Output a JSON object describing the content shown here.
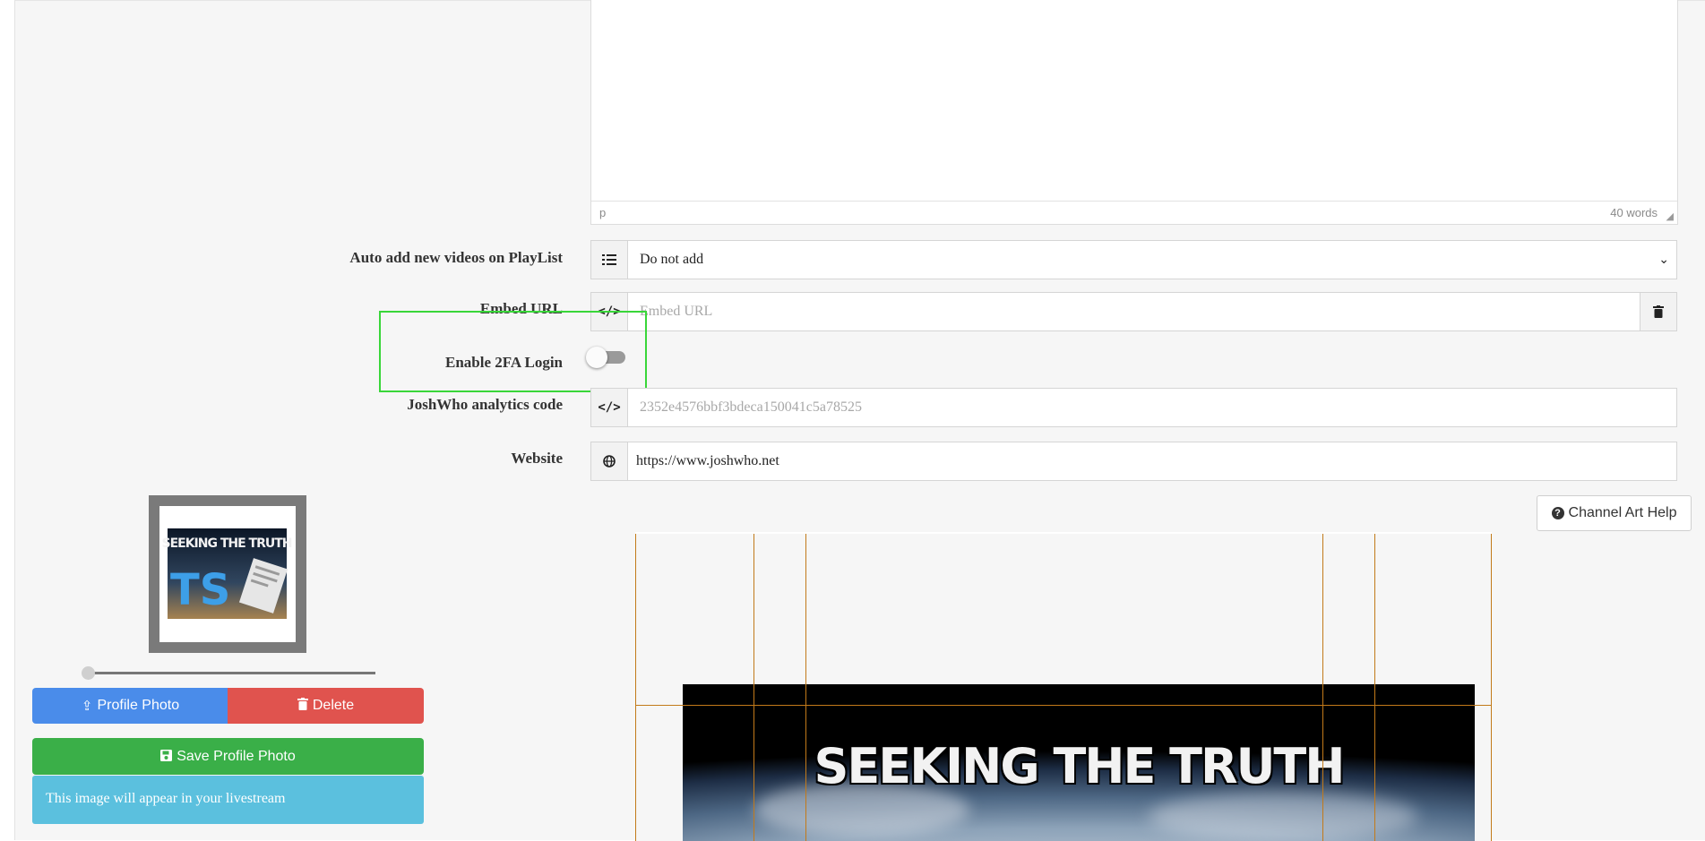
{
  "editor": {
    "status_path": "p",
    "word_count": "40 words"
  },
  "form": {
    "playlist": {
      "label": "Auto add new videos on PlayList",
      "value": "Do not add",
      "icon": "list-icon"
    },
    "embed_url": {
      "label": "Embed URL",
      "placeholder": "Embed URL",
      "icon": "code-icon",
      "trash_icon": "trash-icon"
    },
    "two_factor": {
      "label": "Enable 2FA Login",
      "enabled": false
    },
    "analytics": {
      "label": "JoshWho analytics code",
      "placeholder": "2352e4576bbf3bdeca150041c5a78525",
      "icon": "code-icon"
    },
    "website": {
      "label": "Website",
      "value": "https://www.joshwho.net",
      "icon": "globe-icon"
    }
  },
  "profile": {
    "upload_label": "Profile Photo",
    "delete_label": "Delete",
    "save_label": "Save Profile Photo",
    "info_text": "This image will appear in your livestream",
    "logo_text_top": "SEEKING THE TRUTH",
    "logo_text_ts": "TS",
    "zoom_level": 0
  },
  "channel_art": {
    "help_label": "Channel Art Help",
    "banner_text": "SEEKING THE TRUTH"
  },
  "colors": {
    "highlight": "#39d639",
    "primary": "#4a8cea",
    "danger": "#e0534e",
    "success": "#3aaf48",
    "info": "#5bc0de",
    "guide": "#c27a1a"
  }
}
